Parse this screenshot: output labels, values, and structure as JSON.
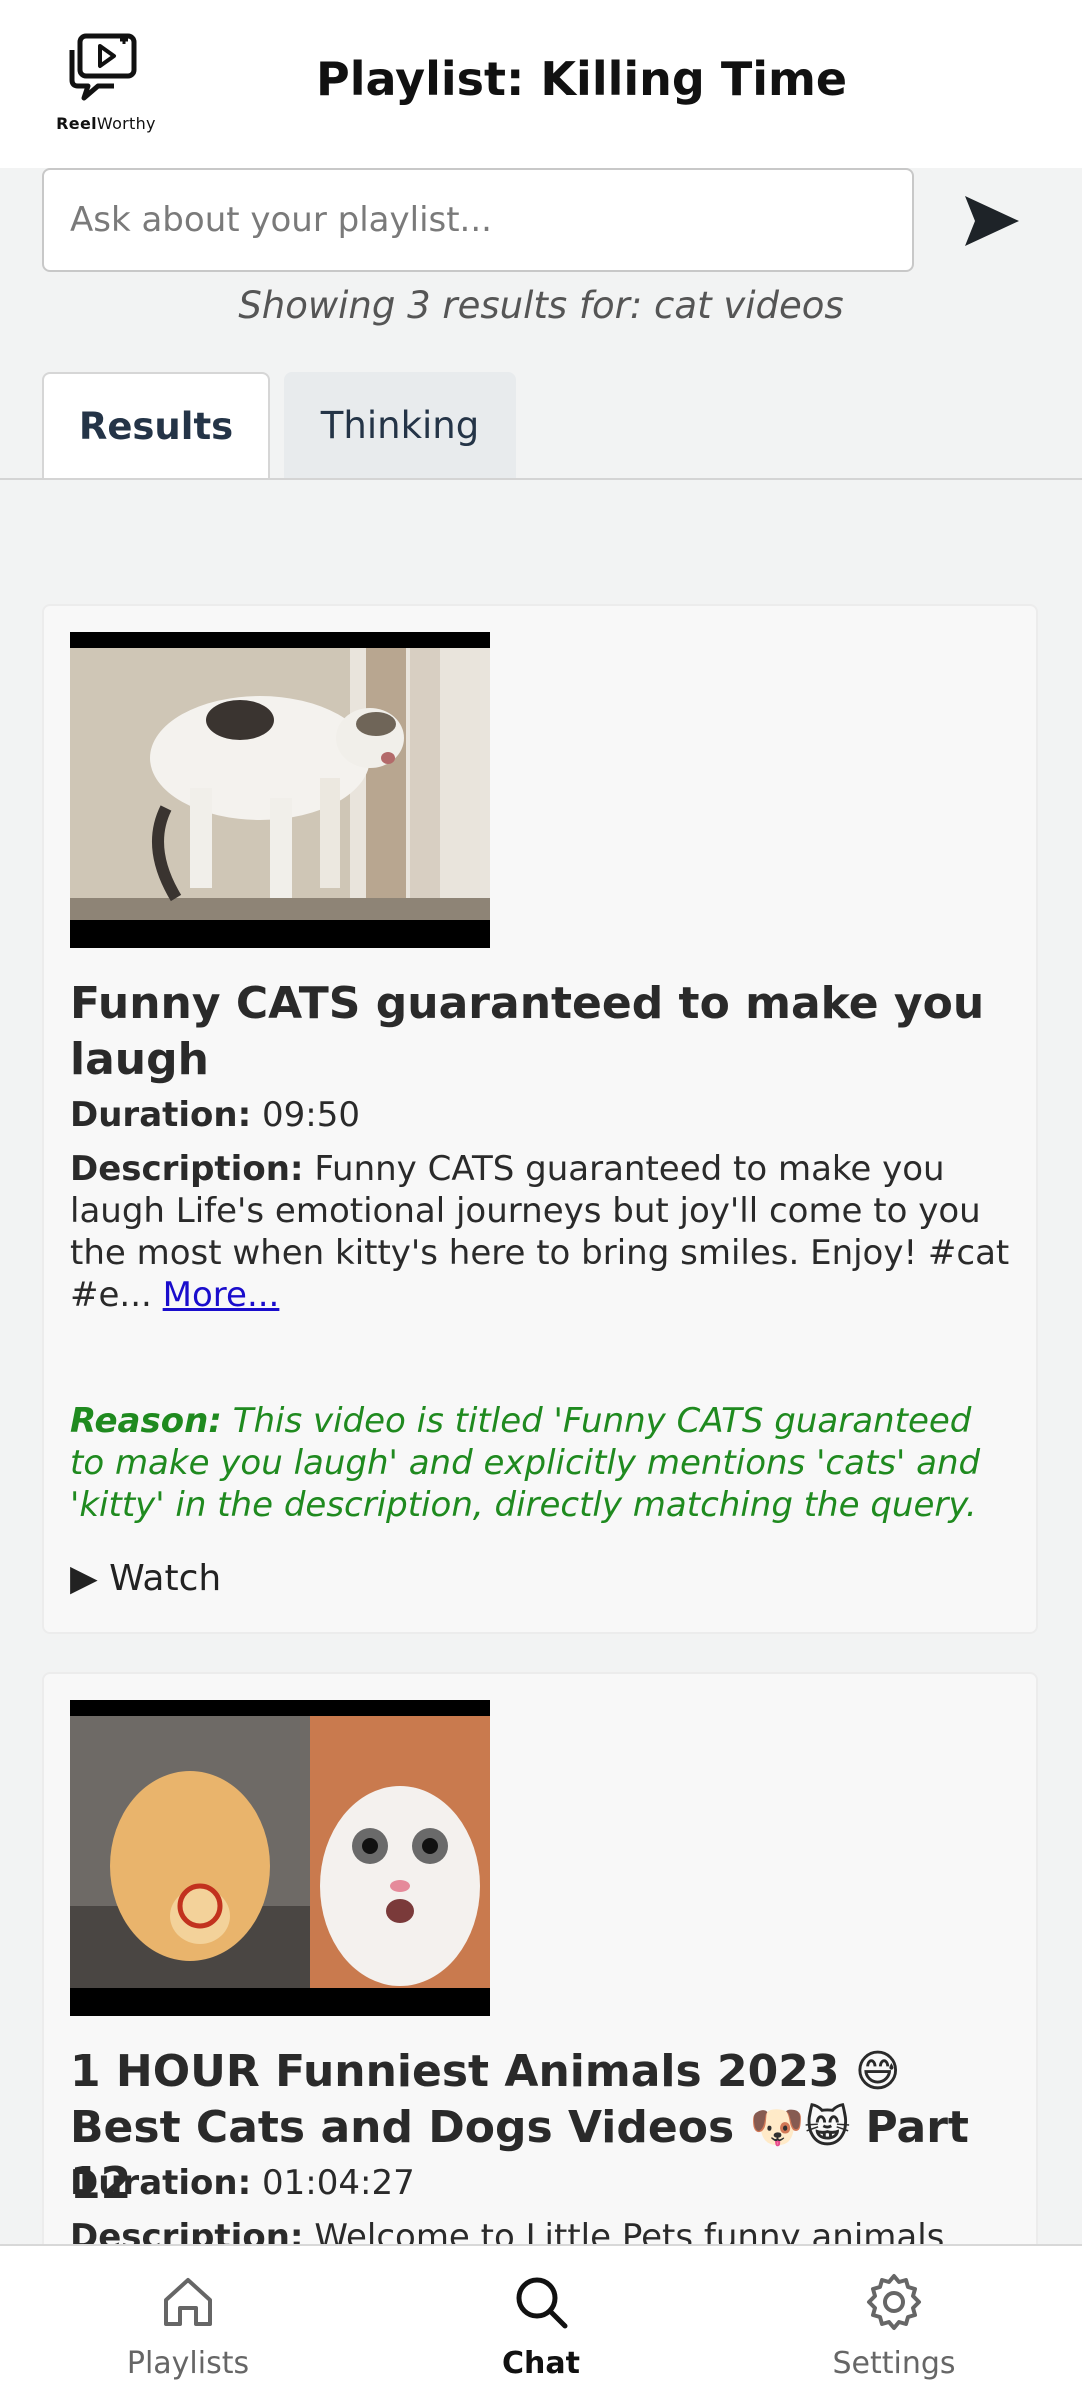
{
  "app": {
    "logo_bold": "Reel",
    "logo_rest": "Worthy",
    "page_title": "Playlist: Killing Time"
  },
  "search": {
    "placeholder": "Ask about your playlist...",
    "value": "",
    "send_icon": "send-arrow-icon"
  },
  "results_caption": "Showing 3 results for: cat videos",
  "tabs": [
    {
      "label": "Results",
      "active": true
    },
    {
      "label": "Thinking",
      "active": false
    }
  ],
  "videos": [
    {
      "title": "Funny CATS guaranteed to make you laugh",
      "duration_label": "Duration:",
      "duration": "09:50",
      "description_label": "Description:",
      "description": "Funny CATS guaranteed to make you laugh Life's emotional journeys but joy'll come to you the most when kitty's here to bring smiles. Enjoy! #cat #e...",
      "more_label": "More...",
      "reason_label": "Reason:",
      "reason": "This video is titled 'Funny CATS guaranteed to make you laugh' and explicitly mentions 'cats' and 'kitty' in the description, directly matching the query.",
      "watch_label": "▶ Watch"
    },
    {
      "title": "1 HOUR Funniest Animals 2023 😅 Best Cats and Dogs Videos 🐶😸 Part 12",
      "duration_label": "Duration:",
      "duration": "01:04:27",
      "description_label": "Description:",
      "description": "Welcome to Little Pets funny animals"
    }
  ],
  "bottom_nav": [
    {
      "label": "Playlists",
      "icon": "home-icon",
      "active": false
    },
    {
      "label": "Chat",
      "icon": "search-icon",
      "active": true
    },
    {
      "label": "Settings",
      "icon": "gear-icon",
      "active": false
    }
  ],
  "colors": {
    "reason_green": "#1f8a1f",
    "link_blue": "#1a0dcc",
    "tab_text": "#243447"
  }
}
